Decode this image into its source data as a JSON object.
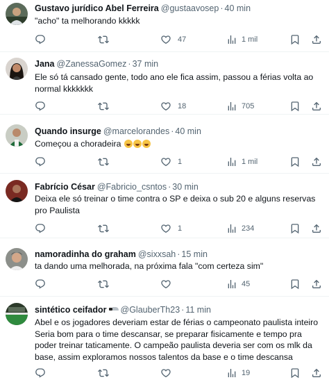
{
  "colors": {
    "text": "#0f1419",
    "muted": "#536471",
    "divider": "#eff3f4"
  },
  "action_icons": [
    "reply-icon",
    "retweet-icon",
    "like-icon",
    "views-icon",
    "bookmark-icon",
    "share-icon"
  ],
  "tweets": [
    {
      "name": "Gustavo jurídico Abel Ferreira",
      "handle": "@gustaavosep",
      "sep": "·",
      "time": "40 min",
      "text": "\"acho\" ta melhorando kkkkk",
      "replies": "",
      "retweets": "",
      "likes": "47",
      "views": "1 mil"
    },
    {
      "name": "Jana",
      "handle": "@ZanessaGomez",
      "sep": "·",
      "time": "37 min",
      "text_lines": [
        "Ele só tá cansado gente, todo ano ele fica assim, passou a férias volta  ao",
        "normal kkkkkkk"
      ],
      "replies": "",
      "retweets": "",
      "likes": "18",
      "views": "705"
    },
    {
      "name": "Quando insurge",
      "handle": "@marcelorandes",
      "sep": "·",
      "time": "40 min",
      "text": "Começou a choradeira",
      "emoji_names": [
        "rofl-emoji",
        "rofl-emoji",
        "rofl-emoji"
      ],
      "replies": "",
      "retweets": "",
      "likes": "1",
      "views": "1 mil"
    },
    {
      "name": "Fabrício César",
      "handle": "@Fabricio_csntos",
      "sep": "·",
      "time": "30 min",
      "text_lines": [
        "Deixa ele só treinar o time contra o SP e deixa o sub 20 e alguns reservas",
        "pro Paulista"
      ],
      "replies": "",
      "retweets": "",
      "likes": "1",
      "views": "234"
    },
    {
      "name": "namoradinha do graham",
      "handle": "@sixxsah",
      "sep": "·",
      "time": "15 min",
      "text": "ta dando uma melhorada, na próxima fala \"com certeza sim\"",
      "replies": "",
      "retweets": "",
      "likes": "",
      "views": "45"
    },
    {
      "name": "sintético ceifador",
      "handle": "@GlauberTh23",
      "sep": "·",
      "time": "11 min",
      "text_lines": [
        "Abel e os jogadores deveriam estar de férias o campeonato paulista inteiro",
        "Seria bom para o time descansar, se preparar fisicamente e tempo pra",
        "poder treinar taticamente. O campeão paulista deveria ser com os mlk da",
        "base, assim exploramos nossos talentos da base e o time descansa"
      ],
      "replies": "",
      "retweets": "",
      "likes": "",
      "views": "19"
    }
  ]
}
